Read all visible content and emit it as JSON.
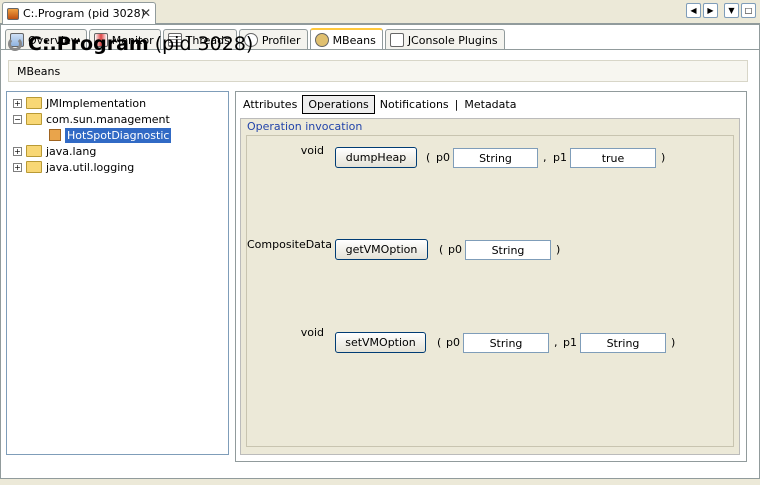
{
  "window": {
    "doc_tab_label": "C:.Program (pid 3028)",
    "close_glyph": "✕",
    "nav_left": "◀",
    "nav_right": "▶",
    "menu_glyph": "▼",
    "max_glyph": "□"
  },
  "tabs": [
    {
      "label": "Overview",
      "icon": "overview-icon"
    },
    {
      "label": "Monitor",
      "icon": "monitor-icon"
    },
    {
      "label": "Threads",
      "icon": "threads-icon"
    },
    {
      "label": "Profiler",
      "icon": "profiler-icon"
    },
    {
      "label": "MBeans",
      "icon": "mbeans-icon"
    },
    {
      "label": "JConsole Plugins",
      "icon": "plugins-icon"
    }
  ],
  "header": {
    "title_bold": "C:.Program",
    "title_pid": "(pid 3028)",
    "breadcrumb": "MBeans"
  },
  "tree": {
    "items": [
      {
        "label": "JMImplementation",
        "expander": "+"
      },
      {
        "label": "com.sun.management",
        "expander": "−"
      },
      {
        "label": "HotSpotDiagnostic"
      },
      {
        "label": "java.lang",
        "expander": "+"
      },
      {
        "label": "java.util.logging",
        "expander": "+"
      }
    ]
  },
  "subtabs": [
    "Attributes",
    "Operations",
    "Notifications",
    "Metadata"
  ],
  "subtab_sep": "|",
  "operation_invocation": {
    "legend": "Operation invocation",
    "ops": [
      {
        "return_type": "void",
        "name": "dumpHeap",
        "open": "(",
        "close": ")",
        "params": [
          {
            "label": "p0",
            "value": "String"
          },
          {
            "label": "p1",
            "value": "true"
          }
        ]
      },
      {
        "return_type": "CompositeData",
        "name": "getVMOption",
        "open": "(",
        "close": ")",
        "params": [
          {
            "label": "p0",
            "value": "String"
          }
        ]
      },
      {
        "return_type": "void",
        "name": "setVMOption",
        "open": "(",
        "close": ")",
        "params": [
          {
            "label": "p0",
            "value": "String"
          },
          {
            "label": "p1",
            "value": "String"
          }
        ]
      }
    ],
    "comma": ","
  }
}
